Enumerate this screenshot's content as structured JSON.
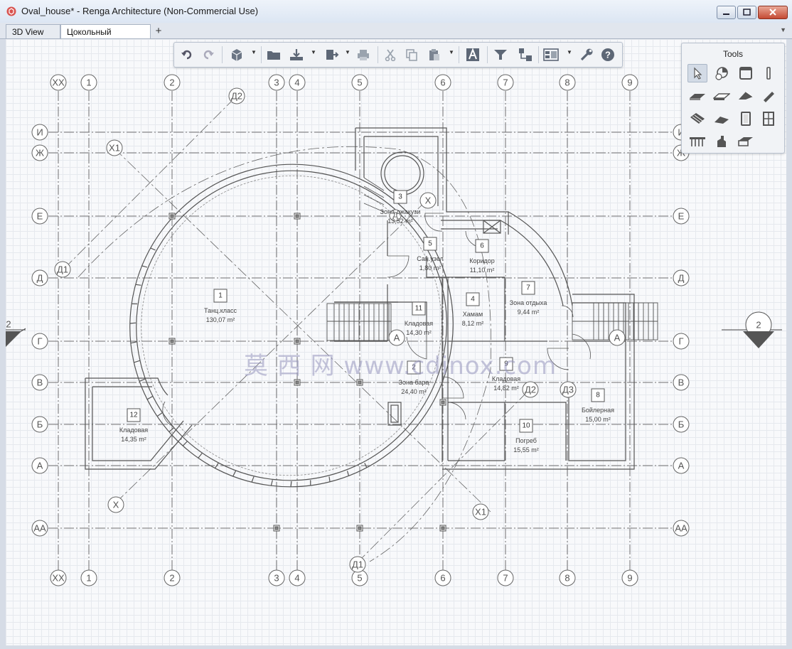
{
  "window": {
    "title": "Oval_house* - Renga Architecture (Non-Commercial Use)"
  },
  "tabs": [
    {
      "label": "3D View",
      "active": false
    },
    {
      "label": "Цокольный этаж",
      "active": true
    }
  ],
  "tools_panel": {
    "title": "Tools"
  },
  "axes": {
    "columns": [
      "XX",
      "1",
      "2",
      "3",
      "4",
      "5",
      "6",
      "7",
      "8",
      "9"
    ],
    "rows": [
      "И",
      "Ж",
      "Е",
      "Д",
      "Г",
      "В",
      "Б",
      "А",
      "АА"
    ],
    "section_mark": "2",
    "diagonal": [
      "Д1",
      "Д2",
      "Д3",
      "X",
      "X1"
    ]
  },
  "rooms": [
    {
      "num": "1",
      "name": "Танц.класс",
      "area": "130,07 m²"
    },
    {
      "num": "2",
      "name": "Зона бара",
      "area": "24,40 m²"
    },
    {
      "num": "3",
      "name": "Зона джакузи",
      "area": "13,52 m²"
    },
    {
      "num": "4",
      "name": "Хамам",
      "area": "8,12 m²"
    },
    {
      "num": "5",
      "name": "Сан.узел",
      "area": "1,80 m²"
    },
    {
      "num": "6",
      "name": "Коридор",
      "area": "11,10 m²"
    },
    {
      "num": "7",
      "name": "Зона отдыха",
      "area": "9,44 m²"
    },
    {
      "num": "8",
      "name": "Бойлерная",
      "area": "15,00 m²"
    },
    {
      "num": "9",
      "name": "Кладовая",
      "area": "14,82 m²"
    },
    {
      "num": "10",
      "name": "Погреб",
      "area": "15,55 m²"
    },
    {
      "num": "11",
      "name": "Кладовая",
      "area": "14,30 m²"
    },
    {
      "num": "12",
      "name": "Кладовая",
      "area": "14,35 m²"
    }
  ],
  "watermark": "莫 西 网 www.cdinox.com",
  "icons": {
    "toolbar": [
      "undo-icon",
      "redo-icon",
      "view-cube-icon",
      "open-folder-icon",
      "import-icon",
      "export-icon",
      "print-icon",
      "cut-icon",
      "copy-icon",
      "paste-icon",
      "text-style-icon",
      "filter-icon",
      "structure-icon",
      "layers-icon",
      "settings-icon",
      "help-icon"
    ],
    "tools": [
      "select-icon",
      "axis-icon",
      "wall-icon",
      "column-icon",
      "slab-icon",
      "floor-icon",
      "roof-icon",
      "beam-icon",
      "stair-icon",
      "ramp-icon",
      "door-icon",
      "window-icon",
      "railing-icon",
      "equipment-icon",
      "opening-icon"
    ]
  }
}
